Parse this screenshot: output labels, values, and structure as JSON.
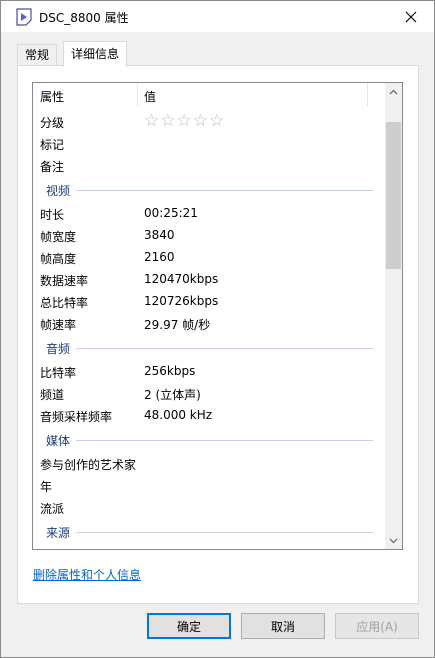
{
  "window": {
    "title": "DSC_8800 属性",
    "accent": "#0078d7"
  },
  "tabs": [
    {
      "label": "常规",
      "active": false
    },
    {
      "label": "详细信息",
      "active": true
    }
  ],
  "list": {
    "columns": {
      "property": "属性",
      "value": "值"
    },
    "rating": {
      "label": "分级",
      "stars": 0,
      "max": 5
    },
    "rows_top": [
      {
        "key": "标记",
        "value": ""
      },
      {
        "key": "备注",
        "value": ""
      }
    ],
    "groups": [
      {
        "name": "视频",
        "rows": [
          {
            "key": "时长",
            "value": "00:25:21"
          },
          {
            "key": "帧宽度",
            "value": "3840"
          },
          {
            "key": "帧高度",
            "value": "2160"
          },
          {
            "key": "数据速率",
            "value": "120470kbps"
          },
          {
            "key": "总比特率",
            "value": "120726kbps"
          },
          {
            "key": "帧速率",
            "value": "29.97 帧/秒"
          }
        ]
      },
      {
        "name": "音频",
        "rows": [
          {
            "key": "比特率",
            "value": "256kbps"
          },
          {
            "key": "频道",
            "value": "2 (立体声)"
          },
          {
            "key": "音频采样频率",
            "value": "48.000 kHz"
          }
        ]
      },
      {
        "name": "媒体",
        "rows": [
          {
            "key": "参与创作的艺术家",
            "value": ""
          },
          {
            "key": "年",
            "value": ""
          },
          {
            "key": "流派",
            "value": ""
          }
        ]
      },
      {
        "name": "来源",
        "rows": []
      }
    ]
  },
  "link_remove": "删除属性和个人信息",
  "buttons": {
    "ok": "确定",
    "cancel": "取消",
    "apply": "应用(A)"
  }
}
